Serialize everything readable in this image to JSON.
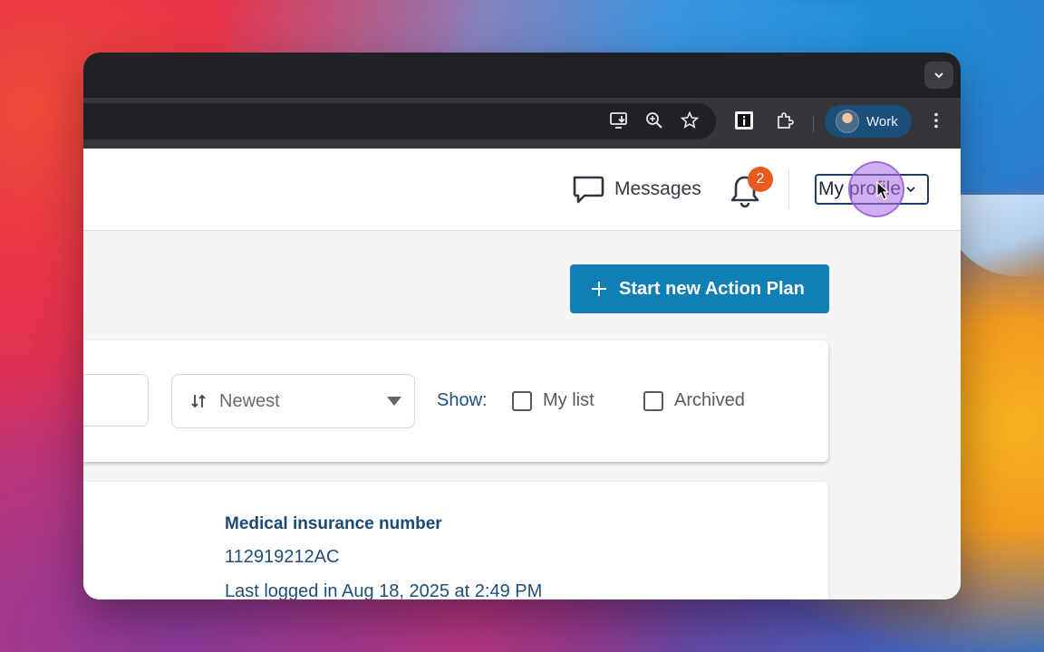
{
  "browser": {
    "profile_name": "Work",
    "toolbar_icons": [
      "install-app-icon",
      "zoom-icon",
      "bookmark-star-icon",
      "extension-info-icon",
      "extensions-puzzle-icon",
      "more-menu-icon"
    ]
  },
  "header": {
    "messages_label": "Messages",
    "notification_count": "2",
    "profile_label": "My profile"
  },
  "actions": {
    "start_plan_label": "Start new Action Plan"
  },
  "filters": {
    "sort_value": "Newest",
    "show_label": "Show:",
    "checkboxes": [
      {
        "label": "My list",
        "checked": false
      },
      {
        "label": "Archived",
        "checked": false
      }
    ]
  },
  "record": {
    "field_label": "Medical insurance number",
    "field_value": "112919212AC",
    "last_logged": "Last logged in Aug 18, 2025 at 2:49 PM"
  },
  "colors": {
    "primary_button": "#0f7fb5",
    "badge": "#ea5a20",
    "link_text": "#1e4f7c",
    "browser_dark": "#202124"
  }
}
